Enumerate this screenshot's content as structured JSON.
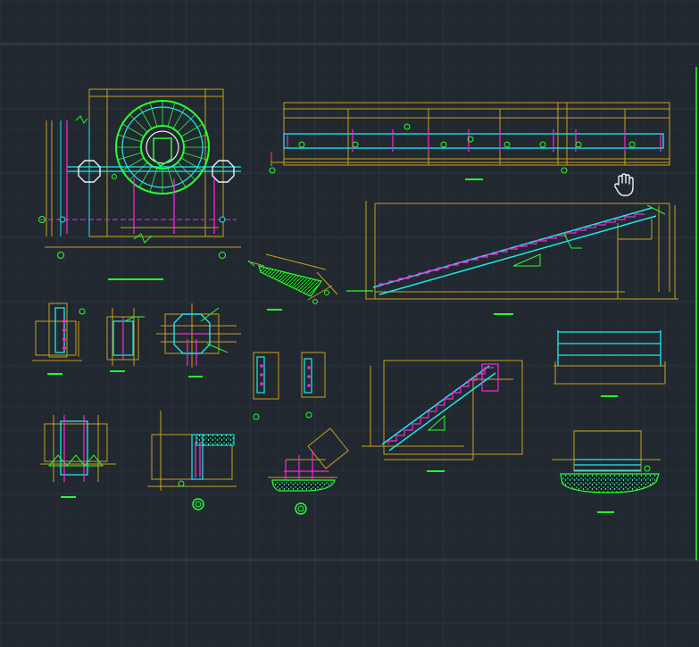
{
  "viewport": {
    "background": "#212830",
    "grid_minor": "#2a323b",
    "grid_major": "#333c46"
  },
  "palette": {
    "green": "#26ff2e",
    "cyan": "#1ee9ee",
    "yellow": "#c9a11a",
    "magenta": "#ff24d8",
    "white": "#f0f0f0",
    "red": "#ff2a2a"
  },
  "drawing": {
    "views": [
      "spiral-stair-plan",
      "stair-elevation-top",
      "long-stair-section",
      "stair-section-middle",
      "railing-elevation",
      "stringer-detail",
      "node-details",
      "base-footing-details",
      "foundation-detail-right"
    ]
  },
  "cursor": {
    "icon": "pan-hand-icon"
  }
}
